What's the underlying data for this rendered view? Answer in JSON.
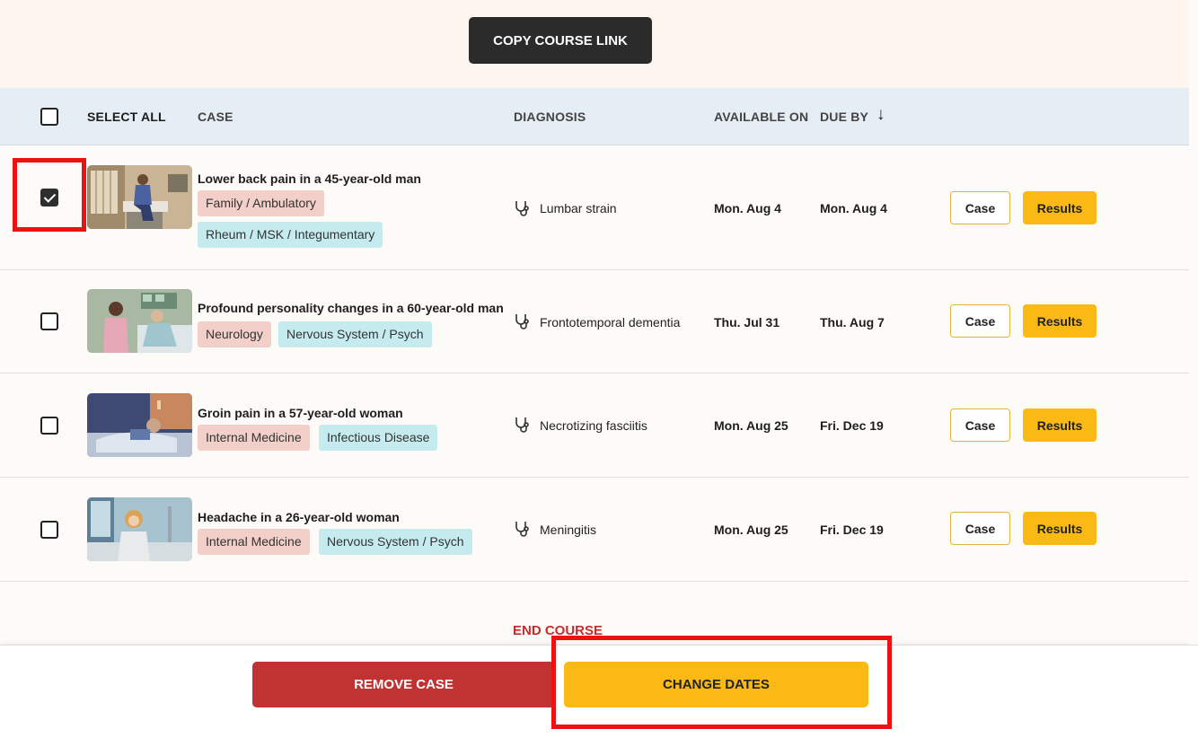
{
  "toolbar": {
    "copy_link_label": "COPY COURSE LINK"
  },
  "table": {
    "headers": {
      "select_all": "SELECT ALL",
      "case": "CASE",
      "diagnosis": "DIAGNOSIS",
      "available_on": "AVAILABLE ON",
      "due_by": "DUE BY"
    },
    "sort_indicator": "↓",
    "rows": [
      {
        "checked": true,
        "title": "Lower back pain in a 45-year-old man",
        "tags": [
          "Family / Ambulatory",
          "Rheum / MSK / Integumentary"
        ],
        "diagnosis": "Lumbar strain",
        "available_on": "Mon. Aug 4",
        "due_by": "Mon. Aug 4",
        "case_label": "Case",
        "results_label": "Results"
      },
      {
        "checked": false,
        "title": "Profound personality changes in a 60-year-old man",
        "tags": [
          "Neurology",
          "Nervous System / Psych"
        ],
        "diagnosis": "Frontotemporal dementia",
        "available_on": "Thu. Jul 31",
        "due_by": "Thu. Aug 7",
        "case_label": "Case",
        "results_label": "Results"
      },
      {
        "checked": false,
        "title": "Groin pain in a 57-year-old woman",
        "tags": [
          "Internal Medicine",
          "Infectious Disease"
        ],
        "diagnosis": "Necrotizing fasciitis",
        "available_on": "Mon. Aug 25",
        "due_by": "Fri. Dec 19",
        "case_label": "Case",
        "results_label": "Results"
      },
      {
        "checked": false,
        "title": "Headache in a 26-year-old woman",
        "tags": [
          "Internal Medicine",
          "Nervous System / Psych"
        ],
        "diagnosis": "Meningitis",
        "available_on": "Mon. Aug 25",
        "due_by": "Fri. Dec 19",
        "case_label": "Case",
        "results_label": "Results"
      }
    ]
  },
  "end_course_label": "END COURSE",
  "footer": {
    "remove_label": "REMOVE CASE",
    "change_dates_label": "CHANGE DATES"
  },
  "colors": {
    "accent_yellow": "#fbb915",
    "danger_red": "#c13333",
    "highlight_red": "#ee1111",
    "tag_pink": "#f3cfc9",
    "tag_blue": "#c6ebef"
  },
  "icons": {
    "diagnosis": "stethoscope-icon",
    "sort": "arrow-down-icon",
    "checkbox": "checkbox-icon"
  }
}
